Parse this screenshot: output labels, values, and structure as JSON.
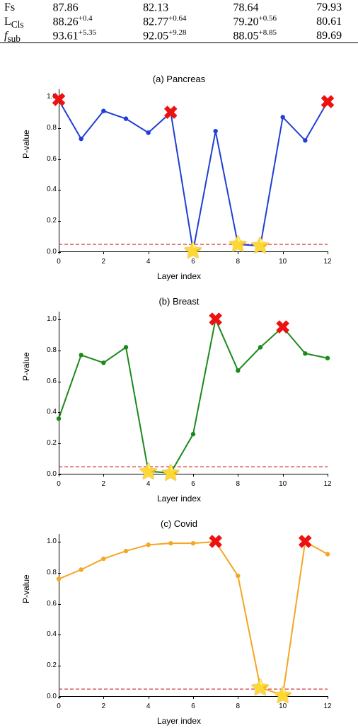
{
  "table": {
    "rows": [
      {
        "name": "Fs",
        "v1": "87.86",
        "s1": "",
        "v2": "82.13",
        "s2": "",
        "v3": "78.64",
        "s3": "",
        "v4": "79.93"
      },
      {
        "name": "L",
        "sub": "Cls",
        "v1": "88.26",
        "s1": "+0.4",
        "v2": "82.77",
        "s2": "+0.64",
        "v3": "79.20",
        "s3": "+0.56",
        "v4": "80.61"
      },
      {
        "name": "f",
        "sub": "sub",
        "v1": "93.61",
        "s1": "+5.35",
        "v2": "92.05",
        "s2": "+9.28",
        "v3": "88.05",
        "s3": "+8.85",
        "v4": "89.69"
      }
    ]
  },
  "chart_data": [
    {
      "type": "line",
      "title": "(a) Pancreas",
      "xlabel": "Layer index",
      "ylabel": "P-value",
      "xlim": [
        0,
        12
      ],
      "ylim": [
        0,
        1.05
      ],
      "threshold": 0.05,
      "color": "#1f3fd6",
      "x": [
        0,
        1,
        2,
        3,
        4,
        5,
        6,
        7,
        8,
        9,
        10,
        11,
        12
      ],
      "y": [
        0.98,
        0.73,
        0.91,
        0.86,
        0.77,
        0.9,
        0.01,
        0.78,
        0.05,
        0.04,
        0.87,
        0.72,
        0.97
      ],
      "cross_x": [
        0,
        5,
        12
      ],
      "star_x": [
        6,
        8,
        9
      ]
    },
    {
      "type": "line",
      "title": "(b) Breast",
      "xlabel": "Layer index",
      "ylabel": "P-value",
      "xlim": [
        0,
        12
      ],
      "ylim": [
        0,
        1.05
      ],
      "threshold": 0.05,
      "color": "#1a8a1a",
      "x": [
        0,
        1,
        2,
        3,
        4,
        5,
        6,
        7,
        8,
        9,
        10,
        11,
        12
      ],
      "y": [
        0.36,
        0.77,
        0.72,
        0.82,
        0.02,
        0.01,
        0.26,
        1.0,
        0.67,
        0.82,
        0.95,
        0.78,
        0.75
      ],
      "cross_x": [
        7,
        10
      ],
      "star_x": [
        4,
        5
      ]
    },
    {
      "type": "line",
      "title": "(c) Covid",
      "xlabel": "Layer index",
      "ylabel": "P-value",
      "xlim": [
        0,
        12
      ],
      "ylim": [
        0,
        1.05
      ],
      "threshold": 0.05,
      "color": "#f5a623",
      "x": [
        0,
        1,
        2,
        3,
        4,
        5,
        6,
        7,
        8,
        9,
        10,
        11,
        12
      ],
      "y": [
        0.76,
        0.82,
        0.89,
        0.94,
        0.98,
        0.99,
        0.99,
        1.0,
        0.78,
        0.06,
        0.01,
        1.0,
        0.92
      ],
      "cross_x": [
        7,
        11
      ],
      "star_x": [
        9,
        10
      ]
    }
  ],
  "panel_tops": [
    104,
    418,
    732
  ],
  "yticks": [
    0.0,
    0.2,
    0.4,
    0.6,
    0.8,
    1.0
  ],
  "xticks": [
    0,
    2,
    4,
    6,
    8,
    10,
    12
  ]
}
